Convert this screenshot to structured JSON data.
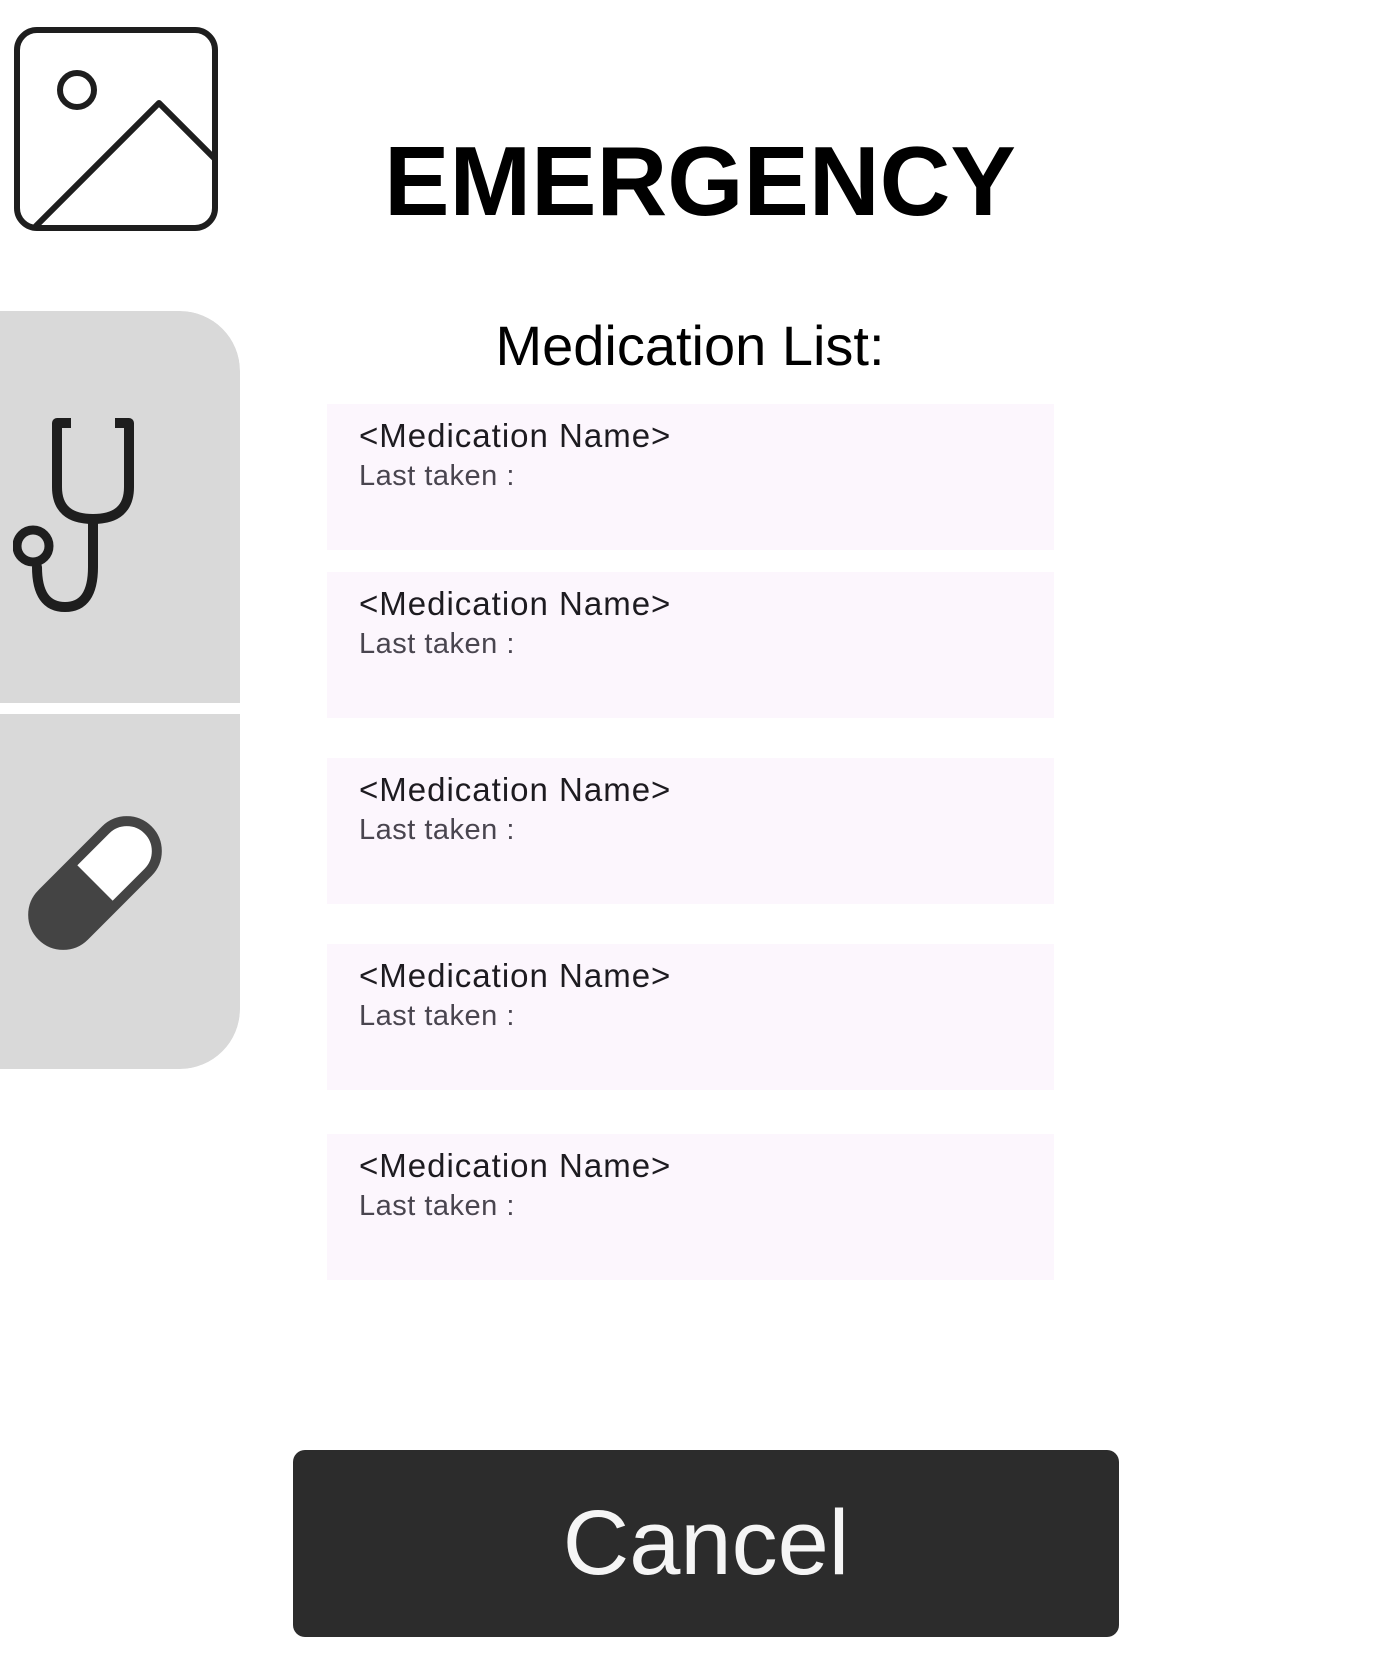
{
  "header": {
    "image_icon": "image-placeholder-icon",
    "title": "EMERGENCY"
  },
  "rail": {
    "items": [
      {
        "icon": "stethoscope-icon"
      },
      {
        "icon": "pill-icon"
      }
    ]
  },
  "section": {
    "title": "Medication List:"
  },
  "medications": [
    {
      "name": "<Medication Name>",
      "last_taken": "Last taken :"
    },
    {
      "name": "<Medication Name>",
      "last_taken": "Last taken :"
    },
    {
      "name": "<Medication Name>",
      "last_taken": "Last taken :"
    },
    {
      "name": "<Medication Name>",
      "last_taken": "Last taken :"
    },
    {
      "name": "<Medication Name>",
      "last_taken": "Last taken :"
    }
  ],
  "footer": {
    "cancel_label": "Cancel"
  },
  "colors": {
    "rail_background": "#d9d9d9",
    "card_background": "#fcf6fd",
    "button_background": "#2c2c2c",
    "button_text": "#f5f5f5"
  }
}
